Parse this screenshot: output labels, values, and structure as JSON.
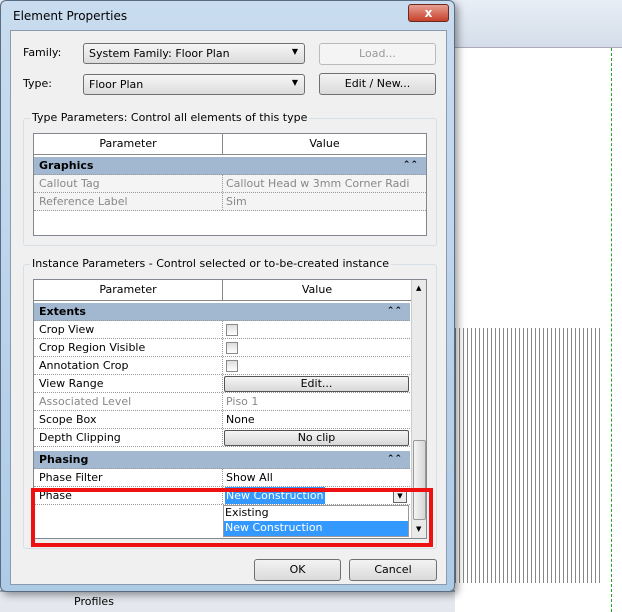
{
  "dialog": {
    "title": "Element Properties",
    "close_label": "x"
  },
  "family": {
    "label": "Family:",
    "value": "System Family: Floor Plan"
  },
  "type": {
    "label": "Type:",
    "value": "Floor Plan"
  },
  "buttons": {
    "load": "Load...",
    "edit_new": "Edit / New...",
    "ok": "OK",
    "cancel": "Cancel"
  },
  "type_params": {
    "title": "Type Parameters: Control all elements of this type",
    "col_param": "Parameter",
    "col_value": "Value",
    "group": "Graphics",
    "rows": [
      {
        "name": "Callout Tag",
        "value": "Callout Head w 3mm Corner Radi"
      },
      {
        "name": "Reference Label",
        "value": "Sim"
      }
    ]
  },
  "instance_params": {
    "title": "Instance Parameters - Control selected or to-be-created instance",
    "col_param": "Parameter",
    "col_value": "Value",
    "groups": [
      {
        "name": "Extents"
      },
      {
        "name": "Phasing"
      }
    ],
    "rows": [
      {
        "name": "Crop View",
        "value": "",
        "checked": false
      },
      {
        "name": "Crop Region Visible",
        "value": "",
        "checked": false
      },
      {
        "name": "Annotation Crop",
        "value": "",
        "checked": false
      },
      {
        "name": "View Range",
        "value": "Edit..."
      },
      {
        "name": "Associated Level",
        "value": "Piso 1"
      },
      {
        "name": "Scope Box",
        "value": "None"
      },
      {
        "name": "Depth Clipping",
        "value": "No clip"
      },
      {
        "name": "Phase Filter",
        "value": "Show All"
      },
      {
        "name": "Phase",
        "value": "New Construction"
      }
    ],
    "phase_options": [
      "Existing",
      "New Construction"
    ]
  },
  "browser": {
    "item": "Profiles"
  },
  "collapse_glyph": "⌃⌃"
}
